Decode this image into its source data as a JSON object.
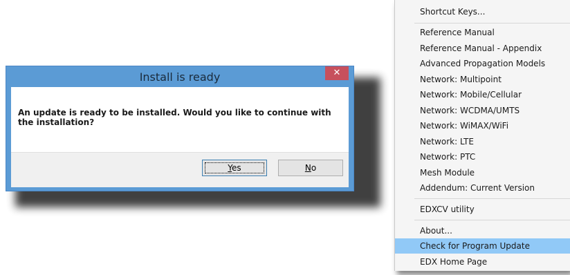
{
  "dialog": {
    "title": "Install is ready",
    "close_glyph": "✕",
    "message": "An update is ready to be installed.  Would you like to continue with the installation?",
    "yes_prefix": "",
    "yes_mnemonic": "Y",
    "yes_rest": "es",
    "no_mnemonic": "N",
    "no_rest": "o"
  },
  "menu": {
    "items": [
      {
        "label": "Shortcut Keys...",
        "highlighted": false
      },
      {
        "label": "Reference Manual",
        "highlighted": false
      },
      {
        "label": "Reference Manual - Appendix",
        "highlighted": false
      },
      {
        "label": "Advanced Propagation Models",
        "highlighted": false
      },
      {
        "label": "Network: Multipoint",
        "highlighted": false
      },
      {
        "label": "Network: Mobile/Cellular",
        "highlighted": false
      },
      {
        "label": "Network: WCDMA/UMTS",
        "highlighted": false
      },
      {
        "label": "Network: WiMAX/WiFi",
        "highlighted": false
      },
      {
        "label": "Network: LTE",
        "highlighted": false
      },
      {
        "label": "Network: PTC",
        "highlighted": false
      },
      {
        "label": "Mesh Module",
        "highlighted": false
      },
      {
        "label": "Addendum: Current Version",
        "highlighted": false
      },
      {
        "label": "EDXCV utility",
        "highlighted": false
      },
      {
        "label": "About...",
        "highlighted": false
      },
      {
        "label": "Check for Program Update",
        "highlighted": true
      },
      {
        "label": "EDX Home Page",
        "highlighted": false
      }
    ]
  },
  "colors": {
    "dialog_frame": "#5b9bd5",
    "close_button": "#c7505d",
    "menu_highlight": "#91c9f7"
  }
}
